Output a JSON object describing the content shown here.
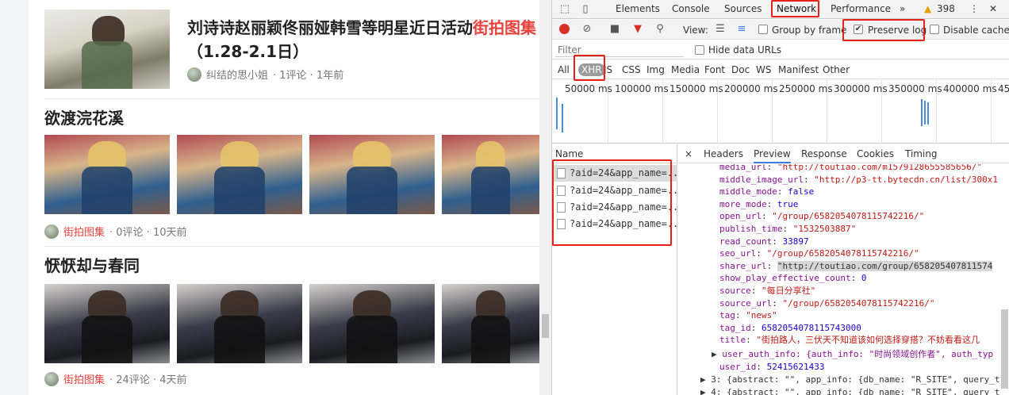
{
  "feed": {
    "article1": {
      "title_main": "刘诗诗赵丽颖佟丽娅韩雪等明星近日活动",
      "title_highlight": "街拍图集",
      "title_line2": "（1.28-2.1日）",
      "author": "纠结的思小姐",
      "stats": "· 1评论 · 1年前"
    },
    "article2": {
      "title": "欲渡浣花溪",
      "source": "街拍图集",
      "stats": "· 0评论 · 10天前"
    },
    "article3": {
      "title": "恹恹却与春同",
      "source": "街拍图集",
      "stats": "· 24评论 · 4天前"
    }
  },
  "devtools": {
    "tabs": [
      "Elements",
      "Console",
      "Sources",
      "Network",
      "Performance"
    ],
    "more": "»",
    "warning_count": "398",
    "toolbar": {
      "view_label": "View:",
      "group_by_frame": "Group by frame",
      "preserve_log": "Preserve log",
      "preserve_log_checked": true,
      "disable_cache": "Disable cache"
    },
    "filter_placeholder": "Filter",
    "hide_data_urls": "Hide data URLs",
    "type_filters": [
      "All",
      "XHR",
      "JS",
      "CSS",
      "Img",
      "Media",
      "Font",
      "Doc",
      "WS",
      "Manifest",
      "Other"
    ],
    "active_type": "XHR",
    "timeline_ticks": [
      "50000 ms",
      "100000 ms",
      "150000 ms",
      "200000 ms",
      "250000 ms",
      "300000 ms",
      "350000 ms",
      "400000 ms",
      "45"
    ],
    "name_header": "Name",
    "requests": [
      "?aid=24&app_name=...",
      "?aid=24&app_name=...",
      "?aid=24&app_name=...",
      "?aid=24&app_name=..."
    ],
    "detail_tabs": [
      "Headers",
      "Preview",
      "Response",
      "Cookies",
      "Timing"
    ],
    "active_detail_tab": "Preview",
    "close_glyph": "×",
    "preview_lines": [
      {
        "key": "media_url",
        "value": "\"http://toutiao.com/m1579128655585656/\"",
        "type": "s"
      },
      {
        "key": "middle_image_url",
        "value": "\"http://p3-tt.bytecdn.cn/list/300x1",
        "type": "s"
      },
      {
        "key": "middle_mode",
        "value": "false",
        "type": "n"
      },
      {
        "key": "more_mode",
        "value": "true",
        "type": "n"
      },
      {
        "key": "open_url",
        "value": "\"/group/6582054078115742216/\"",
        "type": "s"
      },
      {
        "key": "publish_time",
        "value": "\"1532503887\"",
        "type": "s"
      },
      {
        "key": "read_count",
        "value": "33897",
        "type": "n"
      },
      {
        "key": "seo_url",
        "value": "\"/group/6582054078115742216/\"",
        "type": "s"
      },
      {
        "key": "share_url",
        "value": "\"http://toutiao.com/group/658205407811574",
        "type": "hi"
      },
      {
        "key": "show_play_effective_count",
        "value": "0",
        "type": "n"
      },
      {
        "key": "source",
        "value": "\"每日分享社\"",
        "type": "s"
      },
      {
        "key": "source_url",
        "value": "\"/group/6582054078115742216/\"",
        "type": "s"
      },
      {
        "key": "tag",
        "value": "\"news\"",
        "type": "s"
      },
      {
        "key": "tag_id",
        "value": "6582054078115743000",
        "type": "n"
      },
      {
        "key": "title",
        "value": "\"街拍路人，三伏天不知道该如何选择穿搭？不妨看看这几",
        "type": "s"
      }
    ],
    "user_auth_line": "user_auth_info: {auth_info: \"时尚领域创作者\", auth_typ",
    "user_id_key": "user_id",
    "user_id_value": "52415621433",
    "row3": "3: {abstract: \"\", app_info: {db_name: \"R_SITE\", query_t",
    "row4": "4: {abstract: \"\", app_info: {db_name: \"R_SITE\", query_t"
  }
}
